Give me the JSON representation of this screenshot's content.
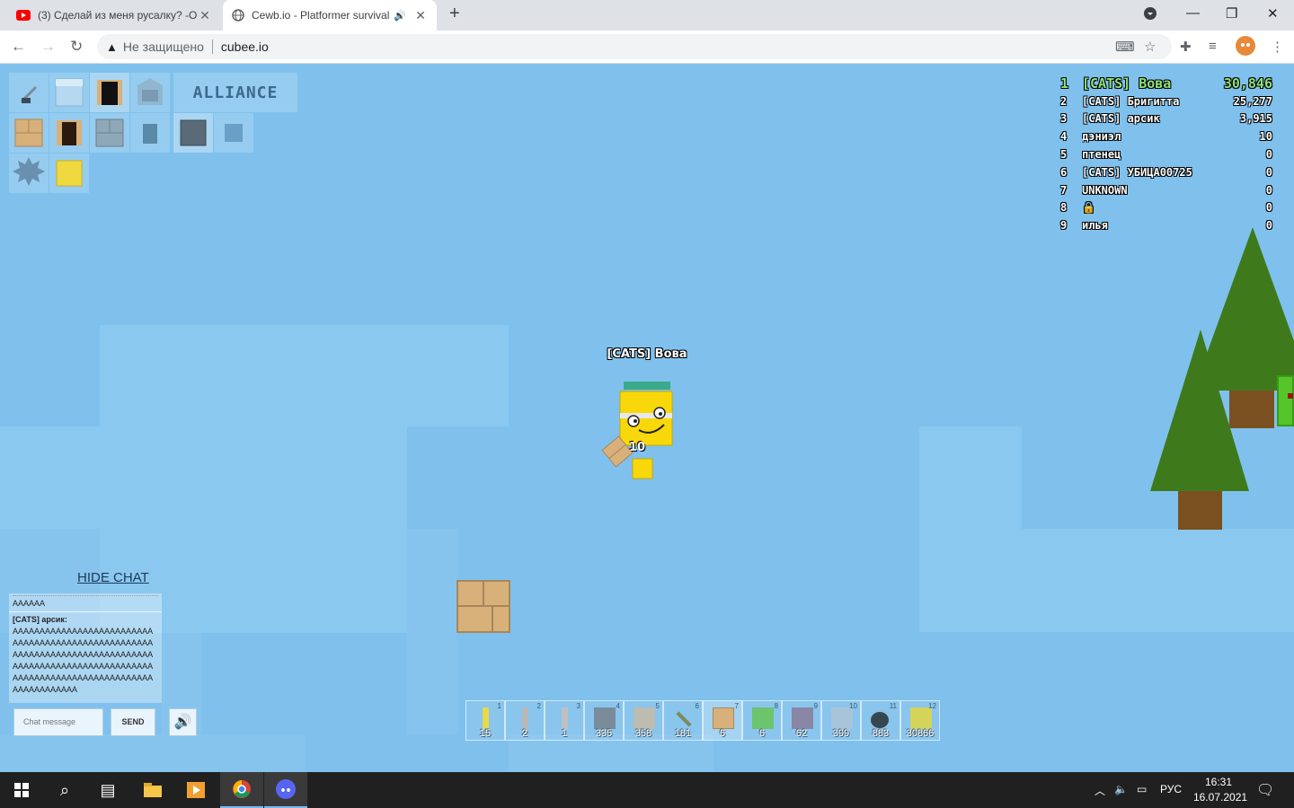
{
  "browser": {
    "tabs": [
      {
        "title": "(3) Сделай из меня русалку? -Ol",
        "icon": "youtube-icon"
      },
      {
        "title": "Cewb.io - Platformer survival",
        "icon": "globe-icon",
        "audio": "speaker-icon"
      }
    ],
    "security_label": "Не защищено",
    "url": "cubee.io"
  },
  "game": {
    "alliance_label": "ALLIANCE",
    "leaderboard": [
      {
        "rank": "1",
        "name": "[CATS] Вова",
        "score": "30,846"
      },
      {
        "rank": "2",
        "name": "[CATS] Бригитта",
        "score": "25,277"
      },
      {
        "rank": "3",
        "name": "[CATS] арсик",
        "score": "3,915"
      },
      {
        "rank": "4",
        "name": "дэниэл",
        "score": "10"
      },
      {
        "rank": "5",
        "name": "птенец",
        "score": "0"
      },
      {
        "rank": "6",
        "name": "[CATS] УБИЦА00725",
        "score": "0"
      },
      {
        "rank": "7",
        "name": "UNKNOWN",
        "score": "0"
      },
      {
        "rank": "8",
        "name": "🔒",
        "score": "0"
      },
      {
        "rank": "9",
        "name": "илья",
        "score": "0"
      }
    ],
    "player_name": "[CATS] Вова",
    "held_count": "10",
    "chat": {
      "hide_label": "HIDE CHAT",
      "messages": [
        {
          "author": "",
          "text": "AAAAAA"
        },
        {
          "author": "[CATS] арсик:",
          "text": "AAAAAAAAAAAAAAAAAAAAAAAAAAAAAAAAAAAAAAAAAAAAAAAAAAAAAAAAAAAAAAAAAAAAAAAAAAAAAAAAAAAAAAAAAAAAAAAAAAAAAAAAAAAAAAAAAAAAAAAAAAAAAAAAAAAAAAAAAAAAAA"
        }
      ],
      "input_placeholder": "Chat message",
      "send_label": "SEND"
    },
    "hotbar": [
      {
        "key": "1",
        "count": "15",
        "color": "#e8d84a"
      },
      {
        "key": "2",
        "count": "2",
        "color": "#b8b8b8"
      },
      {
        "key": "3",
        "count": "1",
        "color": "#c0c0c0"
      },
      {
        "key": "4",
        "count": "335",
        "color": "#7a8c9a"
      },
      {
        "key": "5",
        "count": "358",
        "color": "#bcbcb0"
      },
      {
        "key": "6",
        "count": "181",
        "color": "#7a8a5a"
      },
      {
        "key": "7",
        "count": "6",
        "color": "#d8b07a"
      },
      {
        "key": "8",
        "count": "6",
        "color": "#6cc46c"
      },
      {
        "key": "9",
        "count": "62",
        "color": "#8a86a6"
      },
      {
        "key": "10",
        "count": "399",
        "color": "#a8c4da"
      },
      {
        "key": "11",
        "count": "883",
        "color": "#37474f"
      },
      {
        "key": "12",
        "count": "30866",
        "color": "#d4d45a"
      }
    ]
  },
  "taskbar": {
    "lang": "РУС",
    "time": "16:31",
    "date": "16.07.2021"
  }
}
